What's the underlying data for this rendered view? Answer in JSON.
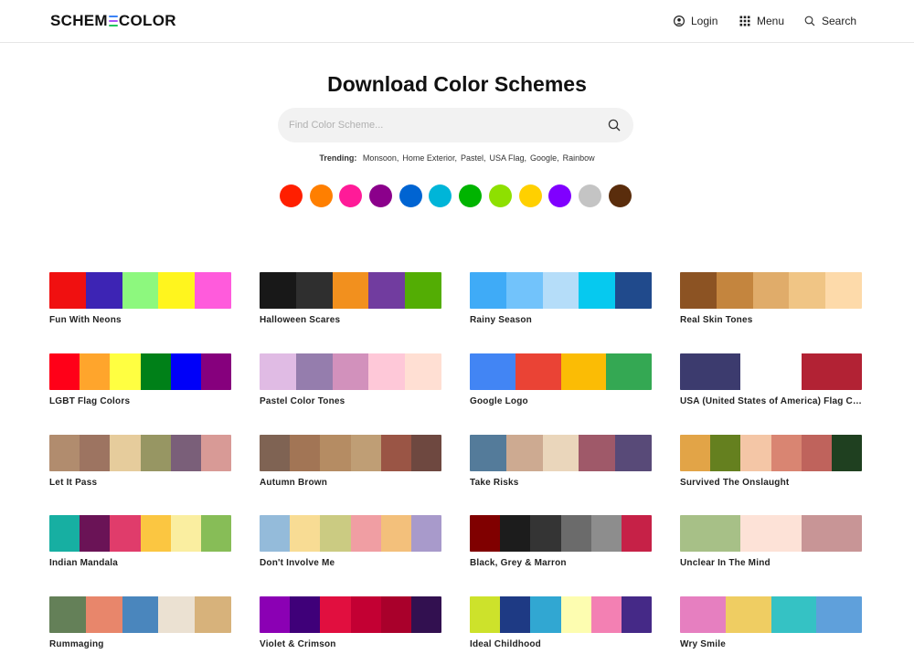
{
  "header": {
    "logo_left": "SCHEM",
    "logo_right": "COLOR",
    "login": "Login",
    "menu": "Menu",
    "search": "Search"
  },
  "hero": {
    "title": "Download Color Schemes",
    "search_placeholder": "Find Color Scheme...",
    "trending_label": "Trending:",
    "trending": [
      "Monsoon",
      "Home Exterior",
      "Pastel",
      "USA Flag",
      "Google",
      "Rainbow"
    ]
  },
  "color_filters": [
    "#ff1f00",
    "#ff7f00",
    "#ff1b98",
    "#8b008b",
    "#0064d2",
    "#00b5d8",
    "#00b400",
    "#8ee000",
    "#ffd000",
    "#8000ff",
    "#c4c4c4",
    "#5a2d0c"
  ],
  "schemes": [
    {
      "name": "Fun With Neons",
      "colors": [
        "#f01010",
        "#3d24b4",
        "#8df87e",
        "#fff51e",
        "#ff5bdc"
      ]
    },
    {
      "name": "Halloween Scares",
      "colors": [
        "#181818",
        "#2f2f2f",
        "#f2901e",
        "#713c9f",
        "#53ad04"
      ]
    },
    {
      "name": "Rainy Season",
      "colors": [
        "#3fabf7",
        "#72c3fb",
        "#b5ddf9",
        "#06c9ef",
        "#204a8c"
      ]
    },
    {
      "name": "Real Skin Tones",
      "colors": [
        "#8c5323",
        "#c4853e",
        "#e0ac6a",
        "#f0c585",
        "#fddaaa"
      ]
    },
    {
      "name": "LGBT Flag Colors",
      "colors": [
        "#ff0018",
        "#ffa52c",
        "#ffff41",
        "#008018",
        "#0000f9",
        "#86007d"
      ]
    },
    {
      "name": "Pastel Color Tones",
      "colors": [
        "#e0bbe4",
        "#957dad",
        "#d291bc",
        "#fec8d8",
        "#ffdfd3"
      ]
    },
    {
      "name": "Google Logo",
      "colors": [
        "#4285f4",
        "#ea4335",
        "#fbbc05",
        "#34a853"
      ]
    },
    {
      "name": "USA (United States of America) Flag Colors",
      "colors": [
        "#3c3b6e",
        "#ffffff",
        "#b22234"
      ]
    },
    {
      "name": "Let It Pass",
      "colors": [
        "#b18c6e",
        "#9d7461",
        "#e6cc9c",
        "#979663",
        "#7a5f79",
        "#d89a96"
      ]
    },
    {
      "name": "Autumn Brown",
      "colors": [
        "#7f6353",
        "#a27555",
        "#b58c63",
        "#bf9e75",
        "#9a5545",
        "#6e4840"
      ]
    },
    {
      "name": "Take Risks",
      "colors": [
        "#547b9a",
        "#cdaa91",
        "#ead6bb",
        "#9f5969",
        "#584a78"
      ]
    },
    {
      "name": "Survived The Onslaught",
      "colors": [
        "#e2a447",
        "#65801f",
        "#f4c6a6",
        "#d98572",
        "#bf635c",
        "#1f4020"
      ]
    },
    {
      "name": "Indian Mandala",
      "colors": [
        "#17afa2",
        "#6a1356",
        "#e03c6b",
        "#fbc641",
        "#faeea0",
        "#87bd57"
      ]
    },
    {
      "name": "Don't Involve Me",
      "colors": [
        "#94bbda",
        "#f8dc94",
        "#cbcb82",
        "#f09ea3",
        "#f3c07b",
        "#a89acb"
      ]
    },
    {
      "name": "Black, Grey & Marron",
      "colors": [
        "#800000",
        "#1c1c1c",
        "#343434",
        "#6b6b6b",
        "#8d8d8d",
        "#c62147"
      ]
    },
    {
      "name": "Unclear In The Mind",
      "colors": [
        "#a7c087",
        "#fde2d7",
        "#c89596"
      ]
    },
    {
      "name": "Rummaging",
      "colors": [
        "#648058",
        "#e8866b",
        "#4a86bd",
        "#ebe1d2",
        "#d7b27b"
      ]
    },
    {
      "name": "Violet & Crimson",
      "colors": [
        "#8b00b4",
        "#3f0079",
        "#e10f3f",
        "#c30033",
        "#a9002b",
        "#321050"
      ]
    },
    {
      "name": "Ideal Childhood",
      "colors": [
        "#cde22b",
        "#1e3a84",
        "#31a7d2",
        "#fdfdb0",
        "#f380b3",
        "#452987"
      ]
    },
    {
      "name": "Wry Smile",
      "colors": [
        "#e67fc0",
        "#efcd62",
        "#35c2c4",
        "#5fa0db"
      ]
    }
  ]
}
